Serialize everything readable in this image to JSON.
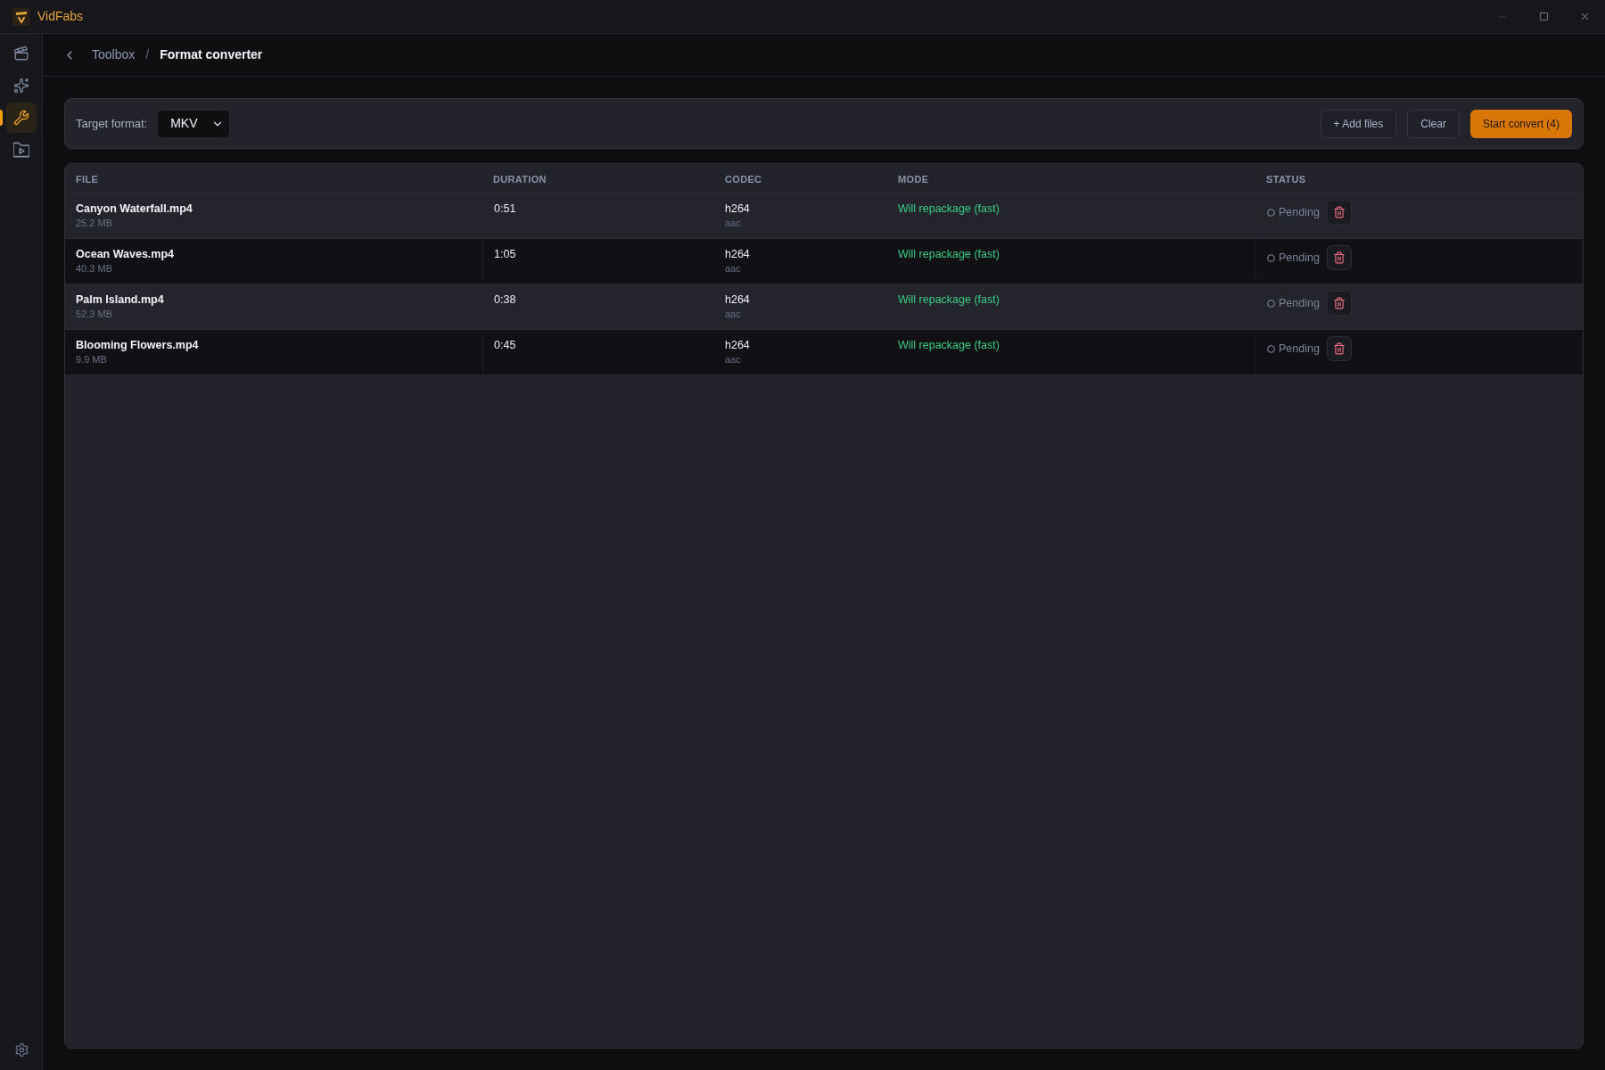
{
  "app": {
    "title": "VidFabs"
  },
  "sidebar": {
    "items": [
      {
        "kind": "clapperboard",
        "selected": false
      },
      {
        "kind": "sparkles",
        "selected": false
      },
      {
        "kind": "wrench",
        "selected": true
      },
      {
        "kind": "folder-play",
        "selected": false
      }
    ]
  },
  "breadcrumb": {
    "items": [
      "Toolbox",
      "Format converter"
    ],
    "separator": "/"
  },
  "toolbar": {
    "label": "Target format:",
    "format": {
      "value": "MKV"
    },
    "buttons": [
      {
        "kind": "secondary",
        "label": "+ Add files"
      },
      {
        "kind": "secondary",
        "label": "Clear"
      },
      {
        "kind": "primary",
        "label": "Start convert (4)"
      }
    ]
  },
  "table": {
    "columns": [
      "FILE",
      "DURATION",
      "CODEC",
      "MODE",
      "STATUS"
    ],
    "rows": [
      {
        "file": "Canyon Waterfall.mp4",
        "size": "25.2 MB",
        "duration": "0:51",
        "codec": "h264",
        "audio_codec": "aac",
        "mode": "Will repackage (fast)",
        "status": "Pending"
      },
      {
        "file": "Ocean Waves.mp4",
        "size": "40.3 MB",
        "duration": "1:05",
        "codec": "h264",
        "audio_codec": "aac",
        "mode": "Will repackage (fast)",
        "status": "Pending"
      },
      {
        "file": "Palm Island.mp4",
        "size": "52.3 MB",
        "duration": "0:38",
        "codec": "h264",
        "audio_codec": "aac",
        "mode": "Will repackage (fast)",
        "status": "Pending"
      },
      {
        "file": "Blooming Flowers.mp4",
        "size": "9.9 MB",
        "duration": "0:45",
        "codec": "h264",
        "audio_codec": "aac",
        "mode": "Will repackage (fast)",
        "status": "Pending"
      }
    ]
  }
}
